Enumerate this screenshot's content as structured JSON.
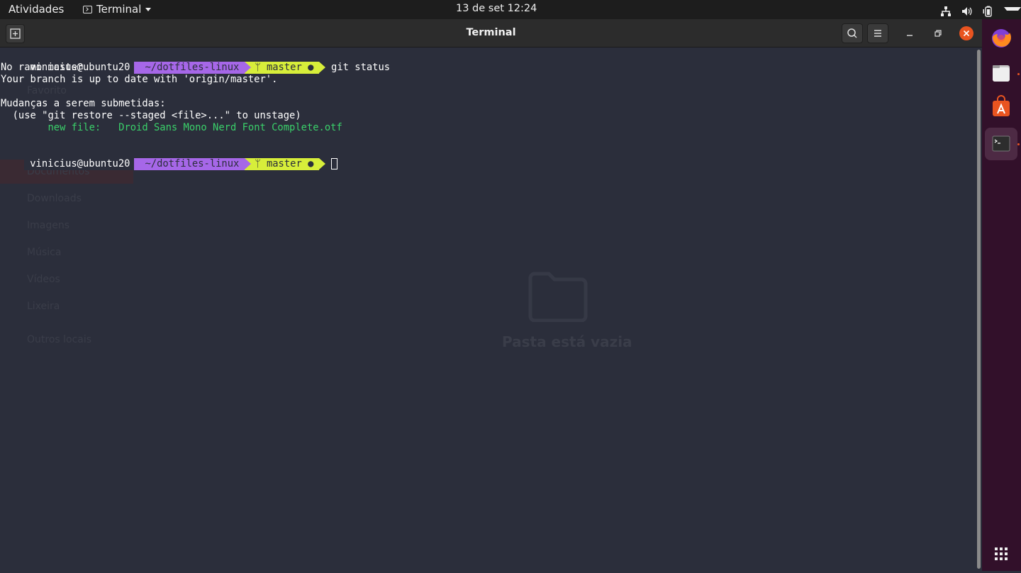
{
  "topbar": {
    "activities": "Atividades",
    "app_name": "Terminal",
    "clock": "13 de set  12:24",
    "tray_icons": [
      "network-icon",
      "volume-icon",
      "battery-icon",
      "system-menu-caret-icon"
    ]
  },
  "window": {
    "title": "Terminal"
  },
  "terminal": {
    "prompt_user": "vinicius@ubuntu20",
    "prompt_dir": "~/dotfiles-linux",
    "prompt_branch": "ᛘ master ●",
    "command": "git status",
    "output": [
      "No ramo master",
      "Your branch is up to date with 'origin/master'.",
      "",
      "Mudanças a serem submetidas:",
      "  (use \"git restore --staged <file>...\" to unstage)"
    ],
    "staged_label": "        new file:   ",
    "staged_file": "Droid Sans Mono Nerd Font Complete.otf"
  },
  "background_ghost": {
    "sidebar_items": [
      "Favorito",
      "Documentos",
      "Downloads",
      "Imagens",
      "Música",
      "Vídeos",
      "Lixeira",
      "Outros locais"
    ],
    "empty_label": "Pasta está vazia"
  },
  "dock": {
    "apps": [
      "firefox-icon",
      "files-icon",
      "software-icon",
      "terminal-icon"
    ],
    "grid": "show-applications-icon"
  },
  "colors": {
    "terminal_bg": "#2b2e3b",
    "dir_segment": "#a667e8",
    "git_segment": "#d7ee3a",
    "staged_green": "#3ad06a",
    "dock_bg": "#32102a",
    "close_button": "#e95420"
  }
}
